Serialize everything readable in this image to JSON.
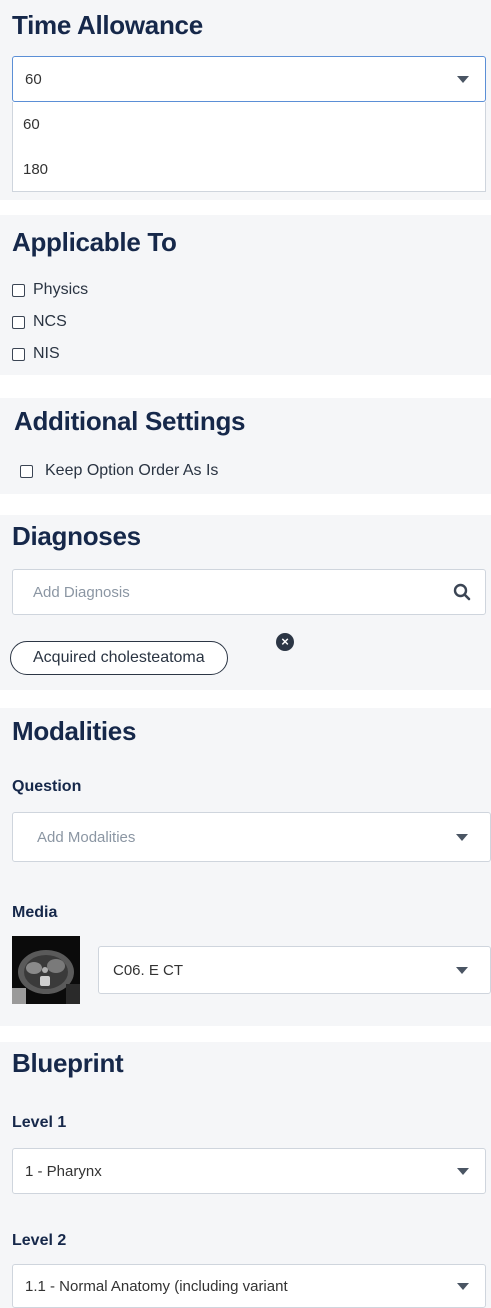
{
  "time_allowance": {
    "title": "Time Allowance",
    "selected": "60",
    "options": [
      "60",
      "180"
    ]
  },
  "applicable_to": {
    "title": "Applicable To",
    "options": [
      "Physics",
      "NCS",
      "NIS"
    ]
  },
  "additional_settings": {
    "title": "Additional Settings",
    "keep_order_label": "Keep Option Order As Is"
  },
  "diagnoses": {
    "title": "Diagnoses",
    "search_placeholder": "Add Diagnosis",
    "chips": [
      "Acquired cholesteatoma"
    ]
  },
  "modalities": {
    "title": "Modalities",
    "question_label": "Question",
    "question_placeholder": "Add Modalities",
    "media_label": "Media",
    "media_value": "C06. E CT"
  },
  "blueprint": {
    "title": "Blueprint",
    "level1_label": "Level 1",
    "level1_value": "1 - Pharynx",
    "level2_label": "Level 2",
    "level2_value": "1.1 - Normal Anatomy (including variant"
  }
}
